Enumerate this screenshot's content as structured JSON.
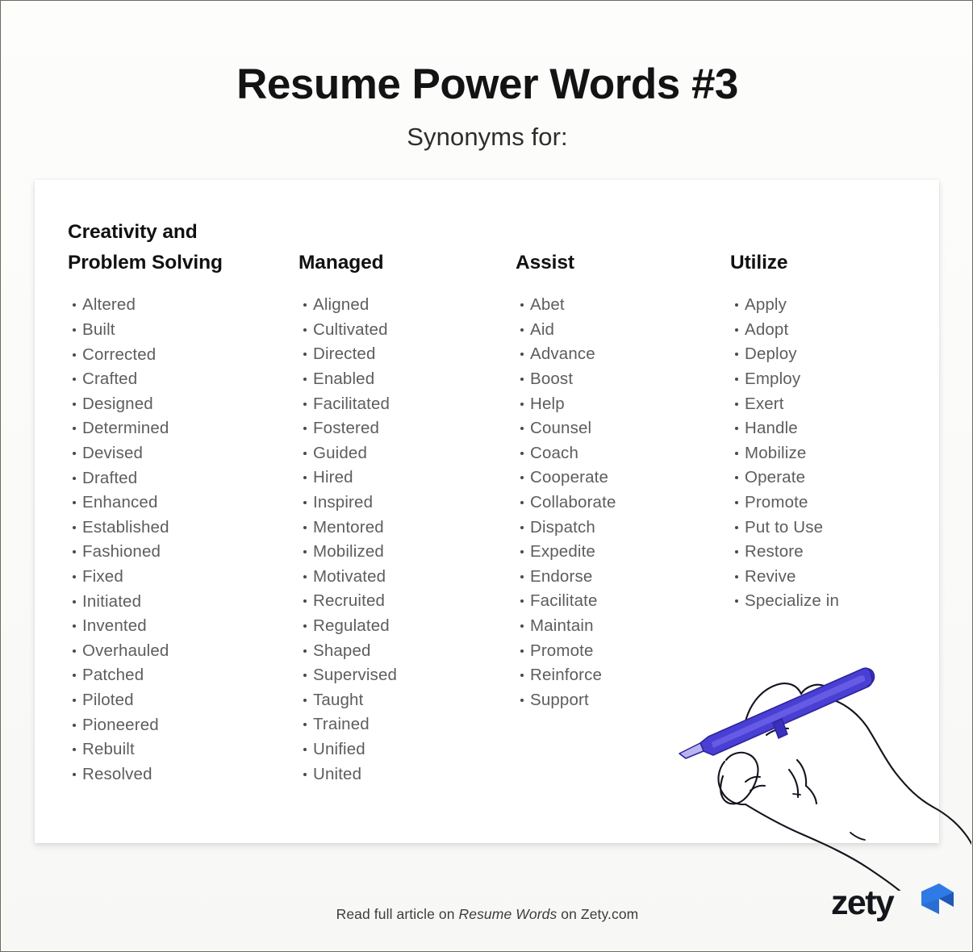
{
  "header": {
    "title": "Resume Power Words #3",
    "subtitle": "Synonyms for:"
  },
  "columns": [
    {
      "heading": "Creativity and\nProblem Solving",
      "words": [
        "Altered",
        "Built",
        "Corrected",
        "Crafted",
        "Designed",
        "Determined",
        "Devised",
        "Drafted",
        "Enhanced",
        "Established",
        "Fashioned",
        "Fixed",
        "Initiated",
        "Invented",
        "Overhauled",
        "Patched",
        "Piloted",
        "Pioneered",
        "Rebuilt",
        "Resolved"
      ]
    },
    {
      "heading": "Managed",
      "words": [
        "Aligned",
        "Cultivated",
        "Directed",
        "Enabled",
        "Facilitated",
        "Fostered",
        "Guided",
        "Hired",
        "Inspired",
        "Mentored",
        "Mobilized",
        "Motivated",
        "Recruited",
        "Regulated",
        "Shaped",
        "Supervised",
        "Taught",
        "Trained",
        "Unified",
        "United"
      ]
    },
    {
      "heading": "Assist",
      "words": [
        "Abet",
        "Aid",
        "Advance",
        "Boost",
        "Help",
        "Counsel",
        "Coach",
        "Cooperate",
        "Collaborate",
        "Dispatch",
        "Expedite",
        "Endorse",
        "Facilitate",
        "Maintain",
        "Promote",
        "Reinforce",
        "Support"
      ]
    },
    {
      "heading": "Utilize",
      "words": [
        "Apply",
        "Adopt",
        "Deploy",
        "Employ",
        "Exert",
        "Handle",
        "Mobilize",
        "Operate",
        "Promote",
        "Put to Use",
        "Restore",
        "Revive",
        "Specialize in"
      ]
    }
  ],
  "illustration": {
    "name": "hand-writing-with-pen",
    "pen_color": "#4a3fd4",
    "line_color": "#14141e"
  },
  "footer": {
    "text_before": "Read full article on ",
    "emphasis": "Resume Words",
    "text_after": " on Zety.com",
    "logo_text": "zety",
    "logo_mark_name": "zety-arrow-mark",
    "logo_color_light": "#2f7ae5",
    "logo_color_dark": "#1f58b8"
  },
  "colors": {
    "page_background": "#fafaf8",
    "card_background": "#ffffff",
    "title": "#131313",
    "heading": "#111111",
    "list_text": "#5d5d5d",
    "border": "#6b6b5e"
  }
}
